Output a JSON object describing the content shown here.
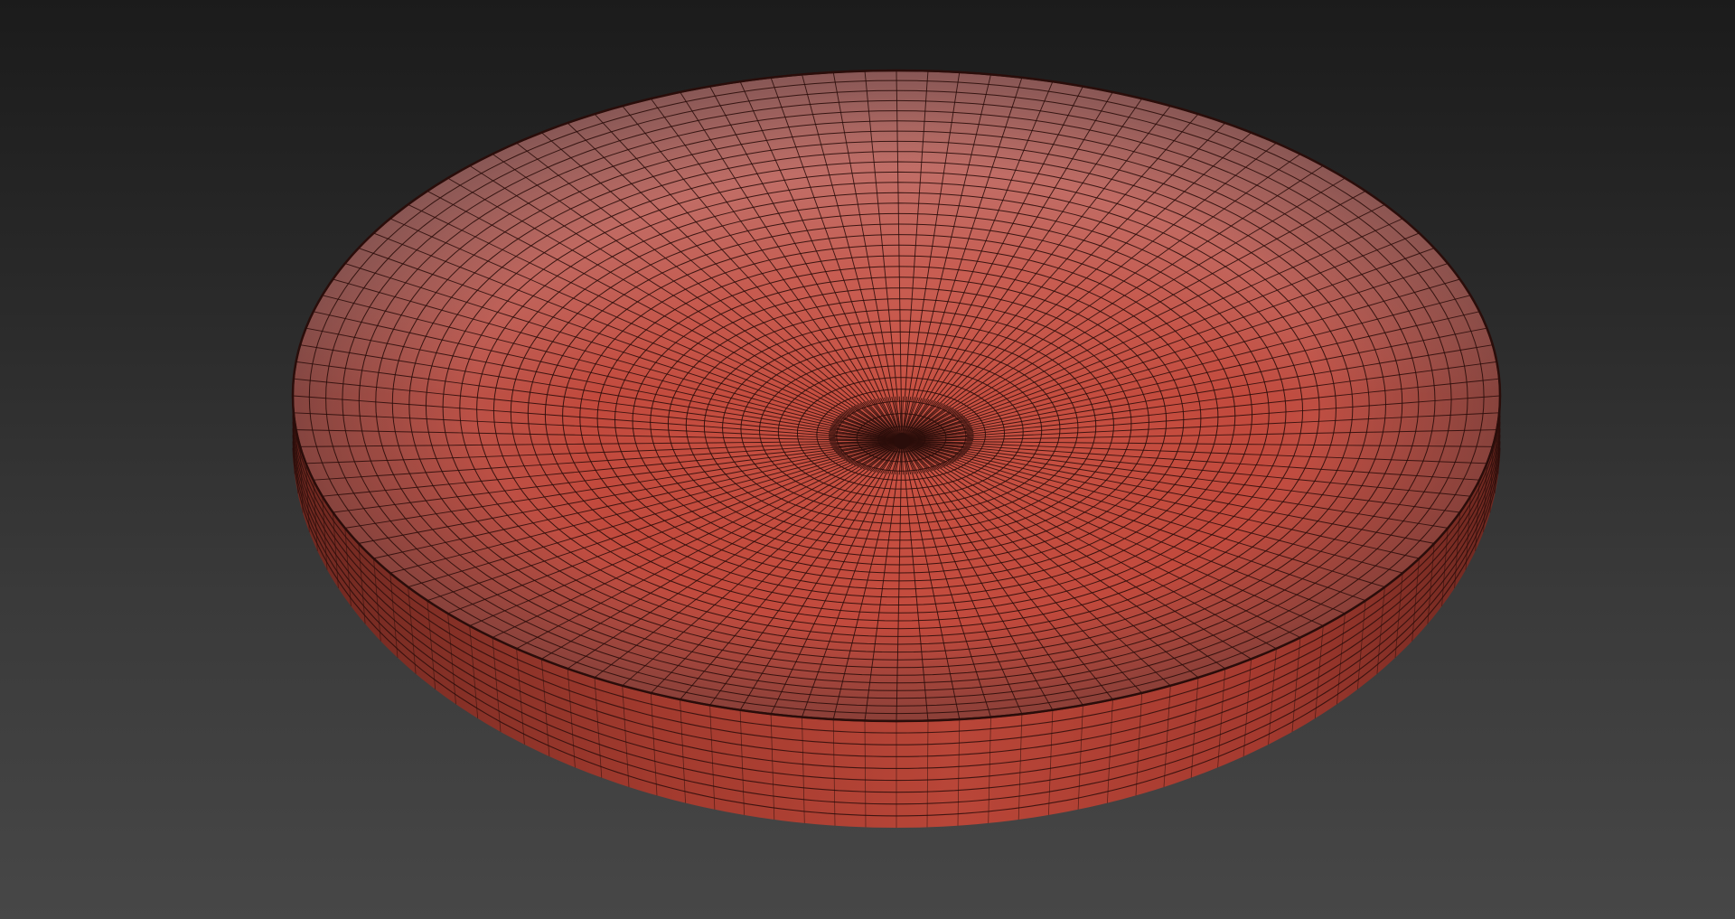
{
  "viewport": {
    "object": "dish-mesh",
    "shading": "wireframe-on-shaded",
    "colors": {
      "background_top": "#1b1b1b",
      "background_bottom": "#474747",
      "mesh_light": "#b86a68",
      "mesh_base": "#c84a3c",
      "mesh_dark": "#7a2a22",
      "wire": "#2a0d0a"
    },
    "topology": {
      "radial_segments": 120,
      "interior_rings": 34,
      "side_bands": 8
    }
  }
}
